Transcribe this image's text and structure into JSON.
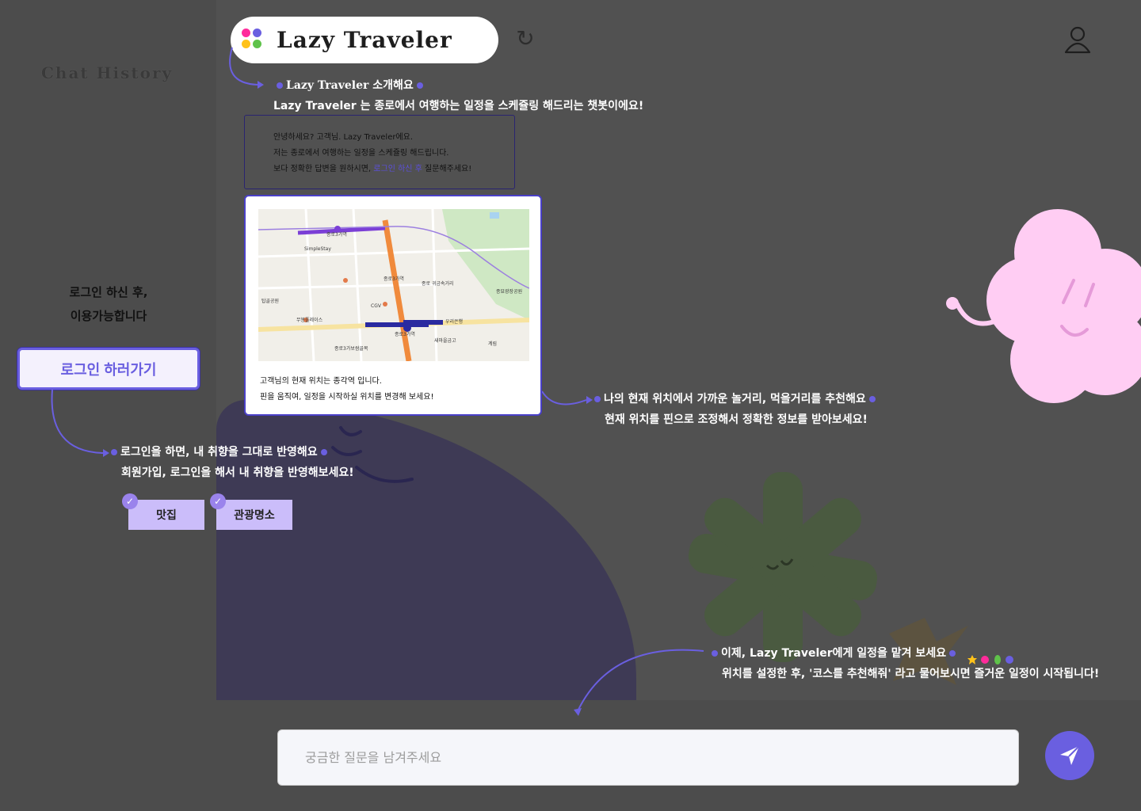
{
  "sidebar": {
    "title": "Chat History",
    "login_note_line1": "로그인 하신 후,",
    "login_note_line2": "이용가능합니다",
    "login_button": "로그인 하러가기"
  },
  "header": {
    "logo_title": "Lazy Traveler"
  },
  "intro": {
    "title_brand": "Lazy Traveler",
    "title_rest": " 소개해요",
    "subtitle": "Lazy Traveler 는 종로에서 여행하는 일정을 스케쥴링 해드리는 챗봇이에요!"
  },
  "chat": {
    "line1": "안녕하세요? 고객님. Lazy Traveler에요.",
    "line2": "저는 종로에서 여행하는 일정을 스케쥴링 해드립니다.",
    "line3_pre": "보다 정확한 답변을 원하시면, ",
    "line3_highlight": "로그인 하신 후",
    "line3_post": " 질문해주세요!"
  },
  "map": {
    "labels": [
      "종로3가역",
      "종로3가역",
      "종로3가역",
      "종로 귀금속거리",
      "종로3가보쌈골목",
      "SimpleStay",
      "CGV",
      "우리은행",
      "무봉플레이스",
      "탑골공원",
      "종묘광장공원",
      "새마을금고",
      "계림"
    ],
    "caption_line1": "고객님의 현재 위치는 종각역 입니다.",
    "caption_line2": "핀을 움직여, 일정을 시작하실 위치를 변경해 보세요!"
  },
  "info_location": {
    "line1": "나의 현재 위치에서 가까운 놀거리, 먹을거리를 추천해요",
    "line2": "현재 위치를 핀으로 조정해서 정확한 정보를 받아보세요!"
  },
  "info_login": {
    "line1": "로그인을 하면, 내 취향을 그대로 반영해요",
    "line2": "회원가입, 로그인을 해서 내 취향을 반영해보세요!"
  },
  "preferences": {
    "tags": [
      "맛집",
      "관광명소"
    ]
  },
  "info_course": {
    "line1": "이제, Lazy Traveler에게 일정을 맡겨 보세요",
    "line2": "위치를 설정한 후, '코스를 추천해줘' 라고 물어보시면 즐거운 일정이 시작됩니다!"
  },
  "input": {
    "placeholder": "궁금한 질문을 남겨주세요",
    "value": ""
  },
  "colors": {
    "accent": "#6a5fe0",
    "background": "#515151",
    "sidebar": "#4c4c4c",
    "blob_dark": "#3e3a55",
    "tag": "#cbbdfa",
    "cloud_pink": "#ffcdf3",
    "star_green": "#4a5a40"
  },
  "icons": [
    "refresh-icon",
    "user-icon",
    "send-icon",
    "check-icon",
    "logo-dots-icon"
  ]
}
